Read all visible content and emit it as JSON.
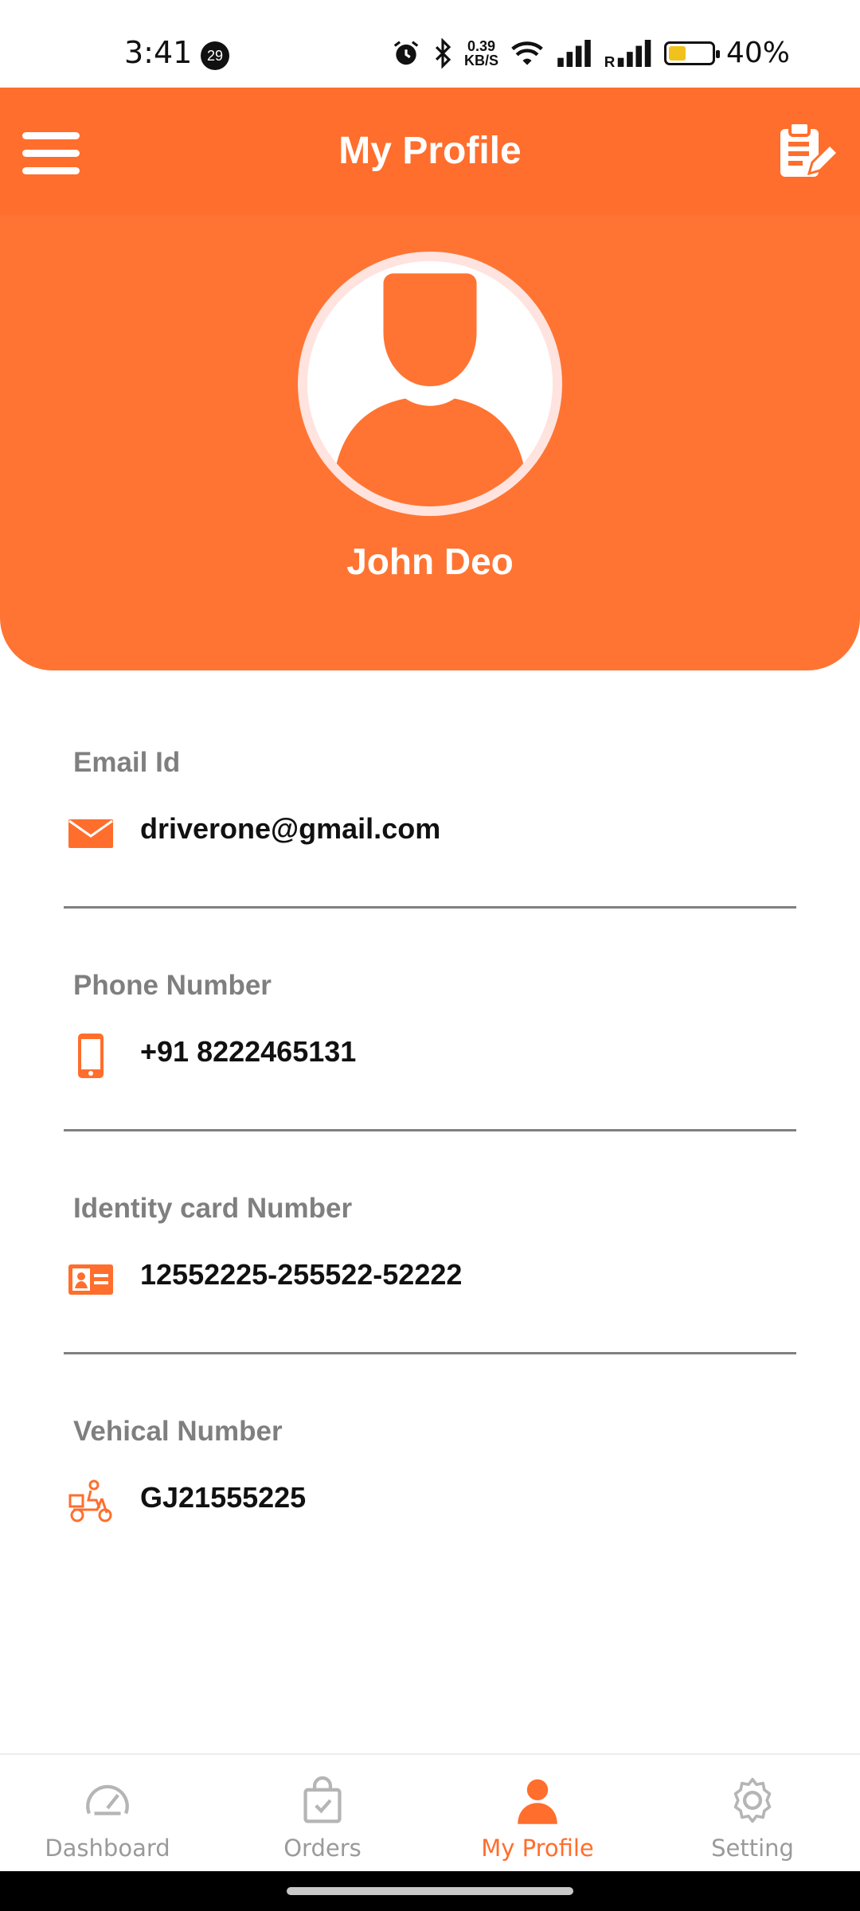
{
  "status_bar": {
    "time": "3:41",
    "notification_count": "29",
    "network_speed_value": "0.39",
    "network_speed_unit": "KB/S",
    "battery_percent": "40%",
    "battery_level": 0.4
  },
  "header": {
    "title": "My Profile",
    "menu_icon": "hamburger-menu-icon",
    "edit_icon": "edit-clipboard-icon"
  },
  "profile": {
    "name": "John Deo",
    "avatar_icon": "user-avatar-icon"
  },
  "fields": {
    "email": {
      "label": "Email Id",
      "value": "driverone@gmail.com",
      "icon": "mail-icon"
    },
    "phone": {
      "label": "Phone Number",
      "value": "+91 8222465131",
      "icon": "phone-icon"
    },
    "identity": {
      "label": "Identity card Number",
      "value": "12552225-255522-52222",
      "icon": "id-card-icon"
    },
    "vehicle": {
      "label": "Vehical Number",
      "value": "GJ21555225",
      "icon": "delivery-scooter-icon"
    }
  },
  "bottom_nav": {
    "items": [
      {
        "label": "Dashboard",
        "icon": "speedometer-icon",
        "active": false
      },
      {
        "label": "Orders",
        "icon": "shopping-bag-icon",
        "active": false
      },
      {
        "label": "My Profile",
        "icon": "person-icon",
        "active": true
      },
      {
        "label": "Setting",
        "icon": "gear-icon",
        "active": false
      }
    ]
  },
  "colors": {
    "accent": "#ff6e2c",
    "hero": "#ff7432",
    "label_gray": "#7f7f7f",
    "value_text": "#111111"
  }
}
